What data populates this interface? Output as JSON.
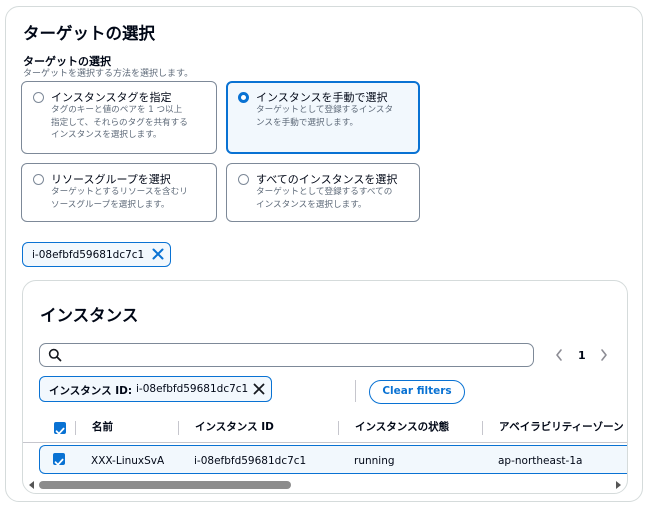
{
  "panel": {
    "title": "ターゲットの選択",
    "field_label": "ターゲットの選択",
    "field_desc": "ターゲットを選択する方法を選択します。"
  },
  "tiles": [
    {
      "title": "インスタンスタグを指定",
      "desc_lines": [
        "タグのキーと値のペアを 1 つ以上",
        "指定して、それらのタグを共有する",
        "インスタンスを選択します。"
      ],
      "selected": false
    },
    {
      "title": "インスタンスを手動で選択",
      "desc_lines": [
        "ターゲットとして登録するインスタ",
        "ンスを手動で選択します。"
      ],
      "selected": true
    },
    {
      "title": "リソースグループを選択",
      "desc_lines": [
        "ターゲットとするリソースを含むリ",
        "ソースグループを選択します。"
      ],
      "selected": false
    },
    {
      "title": "すべてのインスタンスを選択",
      "desc_lines": [
        "ターゲットとして登録するすべての",
        "インスタンスを選択します。"
      ],
      "selected": false
    }
  ],
  "token": {
    "label": "i-08efbfd59681dc7c1",
    "icon": "close-icon"
  },
  "instances": {
    "title": "インスタンス",
    "search": {
      "placeholder": "",
      "icon": "search-icon"
    },
    "pagination": {
      "current_page": "1"
    },
    "filter": {
      "key": "インスタンス ID:",
      "value": "i-08efbfd59681dc7c1"
    },
    "clear_filters_label": "Clear filters",
    "columns": [
      "名前",
      "インスタンス ID",
      "インスタンスの状態",
      "アベイラビリティーゾーン"
    ],
    "rows": [
      {
        "name": "XXX-LinuxSvA",
        "instance_id": "i-08efbfd59681dc7c1",
        "state": "running",
        "az": "ap-northeast-1a",
        "selected": true
      }
    ],
    "scrollbar_position": 0.0
  },
  "colors": {
    "accent": "#0972d3",
    "selected_bg": "#f2f8fd",
    "border": "#7d8998",
    "text": "#000716",
    "muted": "#5f6b7a"
  }
}
